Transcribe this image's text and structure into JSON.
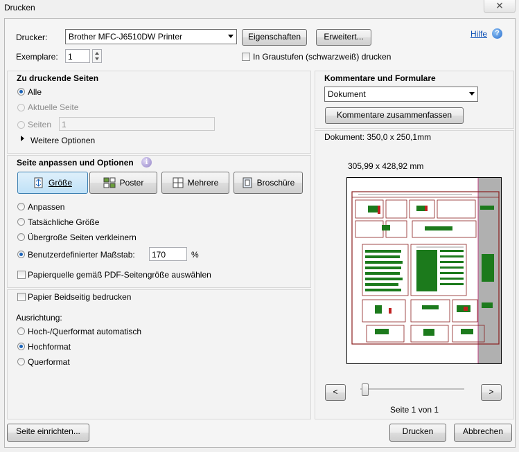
{
  "window": {
    "title": "Drucken",
    "close_glyph": "✕"
  },
  "header": {
    "printer_label": "Drucker:",
    "printer_value": "Brother MFC-J6510DW Printer",
    "properties_button": "Eigenschaften",
    "advanced_button": "Erweitert...",
    "help_link": "Hilfe",
    "help_icon_glyph": "?",
    "copies_label": "Exemplare:",
    "copies_value": "1",
    "grayscale_label": "In Graustufen (schwarzweiß) drucken"
  },
  "pages_section": {
    "title": "Zu druckende Seiten",
    "all_label": "Alle",
    "current_label": "Aktuelle Seite",
    "pages_label": "Seiten",
    "pages_value": "1",
    "more_options_label": "Weitere Optionen",
    "selected": "all"
  },
  "sizing_section": {
    "title": "Seite anpassen und Optionen",
    "info_glyph": "i",
    "tabs": [
      {
        "label": "Größe",
        "icon": "size-icon",
        "active": true
      },
      {
        "label": "Poster",
        "icon": "poster-icon",
        "active": false
      },
      {
        "label": "Mehrere",
        "icon": "multiple-icon",
        "active": false
      },
      {
        "label": "Broschüre",
        "icon": "booklet-icon",
        "active": false
      }
    ],
    "fit_label": "Anpassen",
    "actual_size_label": "Tatsächliche Größe",
    "shrink_label": "Übergroße Seiten verkleinern",
    "custom_scale_label": "Benutzerdefinierter Maßstab:",
    "custom_scale_value": "170",
    "percent_sign": "%",
    "paper_source_label": "Papierquelle gemäß PDF-Seitengröße auswählen",
    "selected": "custom"
  },
  "duplex_section": {
    "duplex_label": "Papier Beidseitig bedrucken",
    "orientation_label": "Ausrichtung:",
    "auto_label": "Hoch-/Querformat automatisch",
    "portrait_label": "Hochformat",
    "landscape_label": "Querformat",
    "selected": "portrait"
  },
  "comments_section": {
    "title": "Kommentare und Formulare",
    "select_value": "Dokument",
    "summarize_button": "Kommentare zusammenfassen"
  },
  "preview": {
    "document_size": "Dokument: 350,0 x 250,1mm",
    "paper_size": "305,99 x 428,92 mm",
    "prev_glyph": "<",
    "next_glyph": ">",
    "page_indicator": "Seite 1 von 1",
    "page_position": 0
  },
  "footer": {
    "page_setup_button": "Seite einrichten...",
    "print_button": "Drucken",
    "cancel_button": "Abbrechen"
  },
  "colors": {
    "accent": "#1b63b8",
    "link": "#0b4fb5",
    "schematic_border": "#8a1f1f",
    "schematic_green": "#1c7a1c",
    "schematic_red": "#c02020"
  }
}
